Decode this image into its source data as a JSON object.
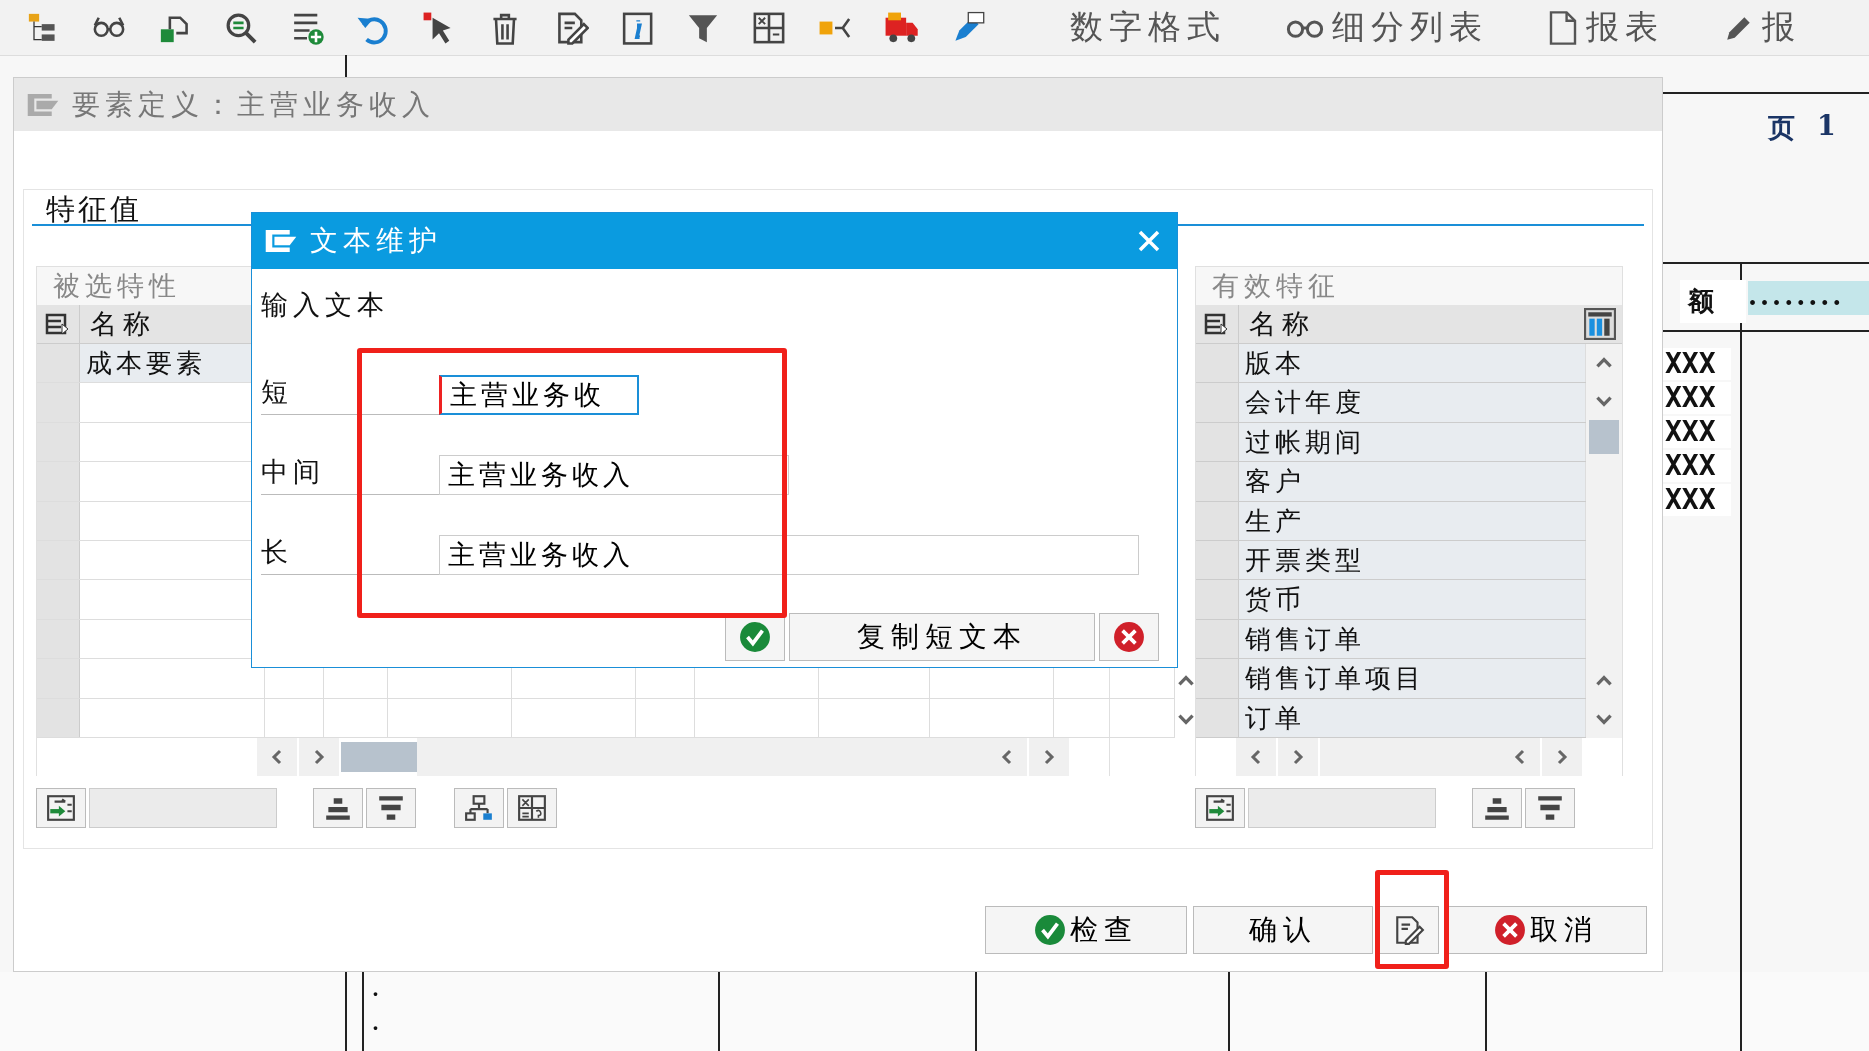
{
  "toolbar": {
    "items": [
      {
        "kind": "text",
        "label": "数字格式"
      },
      {
        "kind": "glasses",
        "label": "细分列表"
      },
      {
        "kind": "document",
        "label": "报表"
      },
      {
        "kind": "pencil",
        "label": "报"
      }
    ]
  },
  "report": {
    "page_label": "页",
    "page_number": "1",
    "column_header": "额",
    "dots_cell": "........",
    "values": [
      "XXX",
      "XXX",
      "XXX",
      "XXX",
      "XXX"
    ],
    "bottom_dots": [
      ".",
      "."
    ]
  },
  "element_dialog": {
    "title": "要素定义：主营业务收入",
    "group_title": "特征值",
    "selected_table": {
      "title": "被选特性",
      "column": "名称",
      "rows": [
        "成本要素"
      ]
    },
    "available_table": {
      "title": "有效特征",
      "column": "名称",
      "rows": [
        "版本",
        "会计年度",
        "过帐期间",
        "客户",
        "生产",
        "开票类型",
        "货币",
        "销售订单",
        "销售订单项目",
        "订单"
      ]
    },
    "buttons": [
      {
        "kind": "check",
        "label": "检查"
      },
      {
        "kind": "plain",
        "label": "确认"
      },
      {
        "kind": "icon"
      },
      {
        "kind": "cancel",
        "label": "取消"
      }
    ]
  },
  "text_dialog": {
    "title": "文本维护",
    "prompt": "输入文本",
    "fields": [
      {
        "label": "短",
        "value": "主营业务收",
        "focused": true
      },
      {
        "label": "中间",
        "value": "主营业务收入",
        "focused": false
      },
      {
        "label": "长",
        "value": "主营业务收入",
        "focused": false
      }
    ],
    "buttons": [
      {
        "kind": "confirm"
      },
      {
        "kind": "text",
        "label": "复制短文本"
      },
      {
        "kind": "cancel"
      }
    ]
  }
}
